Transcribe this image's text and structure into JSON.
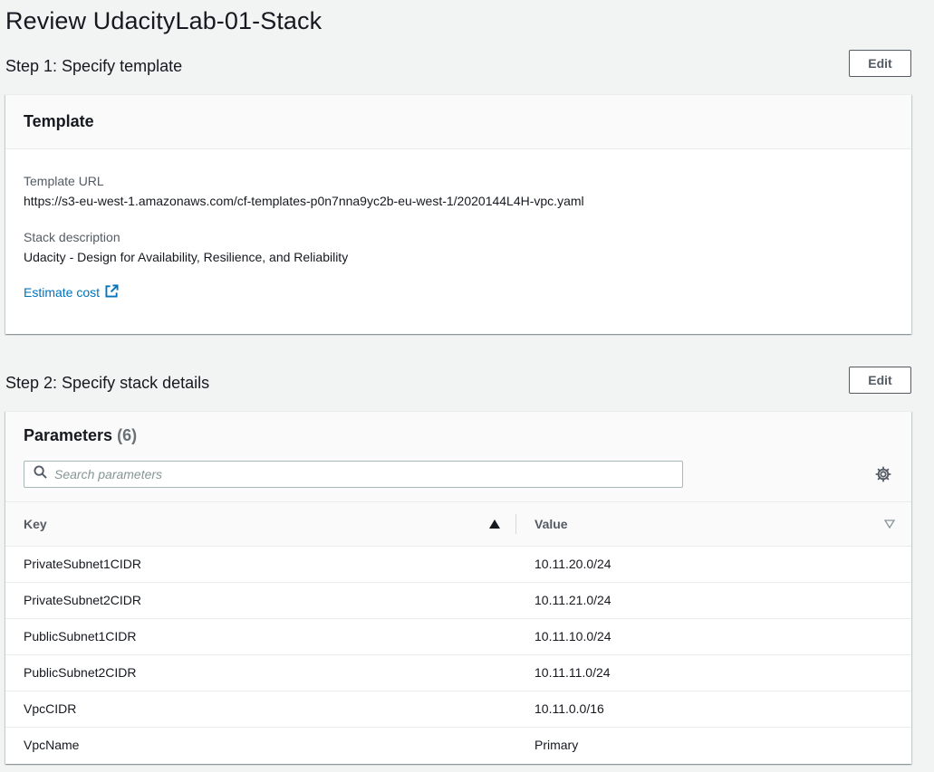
{
  "page": {
    "title": "Review UdacityLab-01-Stack"
  },
  "step1": {
    "title": "Step 1: Specify template",
    "edit_label": "Edit",
    "card_title": "Template",
    "template_url_label": "Template URL",
    "template_url_value": "https://s3-eu-west-1.amazonaws.com/cf-templates-p0n7nna9yc2b-eu-west-1/2020144L4H-vpc.yaml",
    "stack_description_label": "Stack description",
    "stack_description_value": "Udacity - Design for Availability, Resilience, and Reliability",
    "estimate_cost_label": "Estimate cost",
    "external_icon": "external-link-icon"
  },
  "step2": {
    "title": "Step 2: Specify stack details",
    "edit_label": "Edit",
    "parameters_title": "Parameters",
    "parameters_count": "(6)",
    "search_placeholder": "Search parameters",
    "search_icon": "search-icon",
    "settings_icon": "gear-icon",
    "columns": {
      "key": "Key",
      "value": "Value"
    },
    "rows": [
      {
        "key": "PrivateSubnet1CIDR",
        "value": "10.11.20.0/24"
      },
      {
        "key": "PrivateSubnet2CIDR",
        "value": "10.11.21.0/24"
      },
      {
        "key": "PublicSubnet1CIDR",
        "value": "10.11.10.0/24"
      },
      {
        "key": "PublicSubnet2CIDR",
        "value": "10.11.11.0/24"
      },
      {
        "key": "VpcCIDR",
        "value": "10.11.0.0/16"
      },
      {
        "key": "VpcName",
        "value": "Primary"
      }
    ]
  },
  "colors": {
    "link": "#0073bb",
    "text": "#16191f",
    "muted": "#545b64",
    "background": "#f2f3f3"
  }
}
